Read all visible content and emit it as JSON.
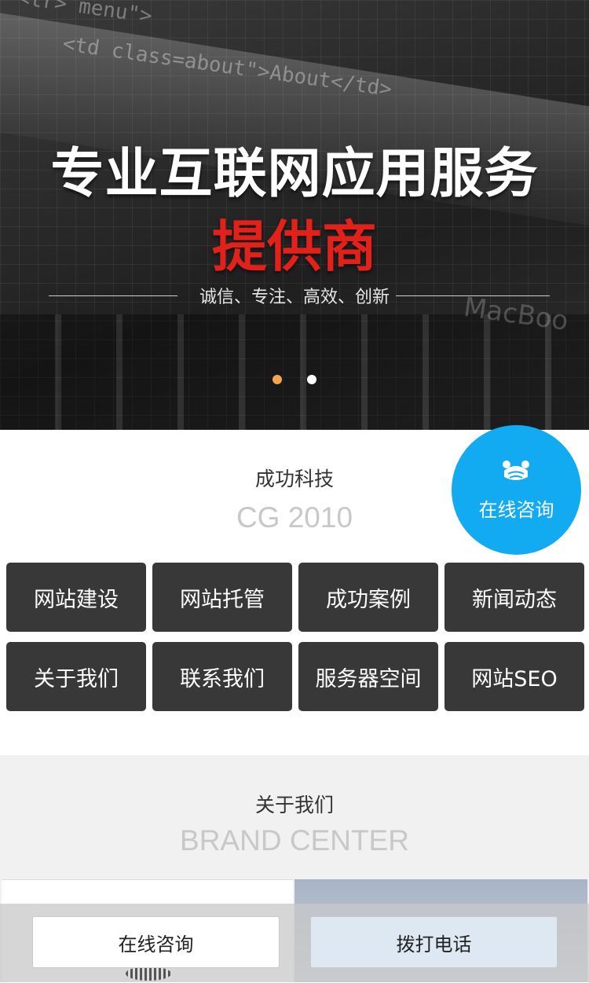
{
  "banner": {
    "code_line1": "<tr>      menu\">",
    "code_line2": "<td class=about\">About</td>",
    "watermark": "MacBoo",
    "title": "专业互联网应用服务",
    "subtitle": "提供商",
    "slogan": "诚信、专注、高效、创新",
    "slides": 2,
    "active_slide": 1
  },
  "float_consult": {
    "label": "在线咨询",
    "icon": "bear-chat-icon"
  },
  "company": {
    "name": "成功科技",
    "sub": "CG 2010"
  },
  "nav": [
    "网站建设",
    "网站托管",
    "成功案例",
    "新闻动态",
    "关于我们",
    "联系我们",
    "服务器空间",
    "网站SEO"
  ],
  "about": {
    "name": "关于我们",
    "sub": "BRAND CENTER"
  },
  "bottom_bar": {
    "consult_label": "在线咨询",
    "call_label": "拨打电话"
  },
  "colors": {
    "accent_blue": "#12aaf0",
    "nav_bg": "#383838",
    "title_red": "#e3211b",
    "dot_active": "#f3a550"
  }
}
